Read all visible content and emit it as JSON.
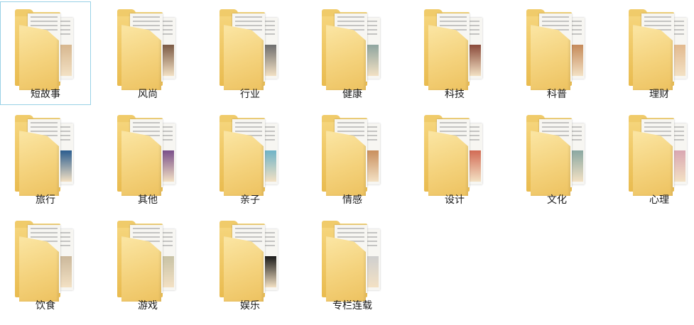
{
  "folders": [
    {
      "label": "短故事",
      "icon": "folder-icon",
      "thumb": "#b9b3a8",
      "thumb2": "#d7b78f",
      "selected": true
    },
    {
      "label": "风尚",
      "icon": "folder-icon",
      "thumb": "#2b2b2b",
      "thumb2": "#7b5a45",
      "selected": false
    },
    {
      "label": "行业",
      "icon": "folder-icon",
      "thumb": "#203a78",
      "thumb2": "#6e6e6e",
      "selected": false
    },
    {
      "label": "健康",
      "icon": "folder-icon",
      "thumb": "#5f7f78",
      "thumb2": "#8fa59f",
      "selected": false
    },
    {
      "label": "科技",
      "icon": "folder-icon",
      "thumb": "#1f7a3b",
      "thumb2": "#8a4a3a",
      "selected": false
    },
    {
      "label": "科普",
      "icon": "folder-icon",
      "thumb": "#5d8ab3",
      "thumb2": "#c58a5a",
      "selected": false
    },
    {
      "label": "理财",
      "icon": "folder-icon",
      "thumb": "#d6c08f",
      "thumb2": "#e2b98e",
      "selected": false
    },
    {
      "label": "旅行",
      "icon": "folder-icon",
      "thumb": "#b6473c",
      "thumb2": "#2a5d8f",
      "selected": false
    },
    {
      "label": "其他",
      "icon": "folder-icon",
      "thumb": "#8fb3b6",
      "thumb2": "#7a4f8a",
      "selected": false
    },
    {
      "label": "亲子",
      "icon": "folder-icon",
      "thumb": "#1a2a6a",
      "thumb2": "#6fb3c7",
      "selected": false
    },
    {
      "label": "情感",
      "icon": "folder-icon",
      "thumb": "#c9c6c0",
      "thumb2": "#c98f5e",
      "selected": false
    },
    {
      "label": "设计",
      "icon": "folder-icon",
      "thumb": "#ecebe7",
      "thumb2": "#d26b55",
      "selected": false
    },
    {
      "label": "文化",
      "icon": "folder-icon",
      "thumb": "#8a6a2b",
      "thumb2": "#8aa8a2",
      "selected": false
    },
    {
      "label": "心理",
      "icon": "folder-icon",
      "thumb": "#efeee8",
      "thumb2": "#d9a6b2",
      "selected": false
    },
    {
      "label": "饮食",
      "icon": "folder-icon",
      "thumb": "#1a2a6a",
      "thumb2": "#cbb89b",
      "selected": false
    },
    {
      "label": "游戏",
      "icon": "folder-icon",
      "thumb": "#1d3a66",
      "thumb2": "#c7c2a5",
      "selected": false
    },
    {
      "label": "娱乐",
      "icon": "folder-icon",
      "thumb": "#2c5a88",
      "thumb2": "#1a1a1a",
      "selected": false
    },
    {
      "label": "专栏连载",
      "icon": "folder-icon",
      "thumb": "#4a4f7a",
      "thumb2": "#cfcfcf",
      "selected": false
    }
  ],
  "colors": {
    "folder": "#f4d27c",
    "selection_border": "#99d1e6",
    "background": "#ffffff"
  }
}
